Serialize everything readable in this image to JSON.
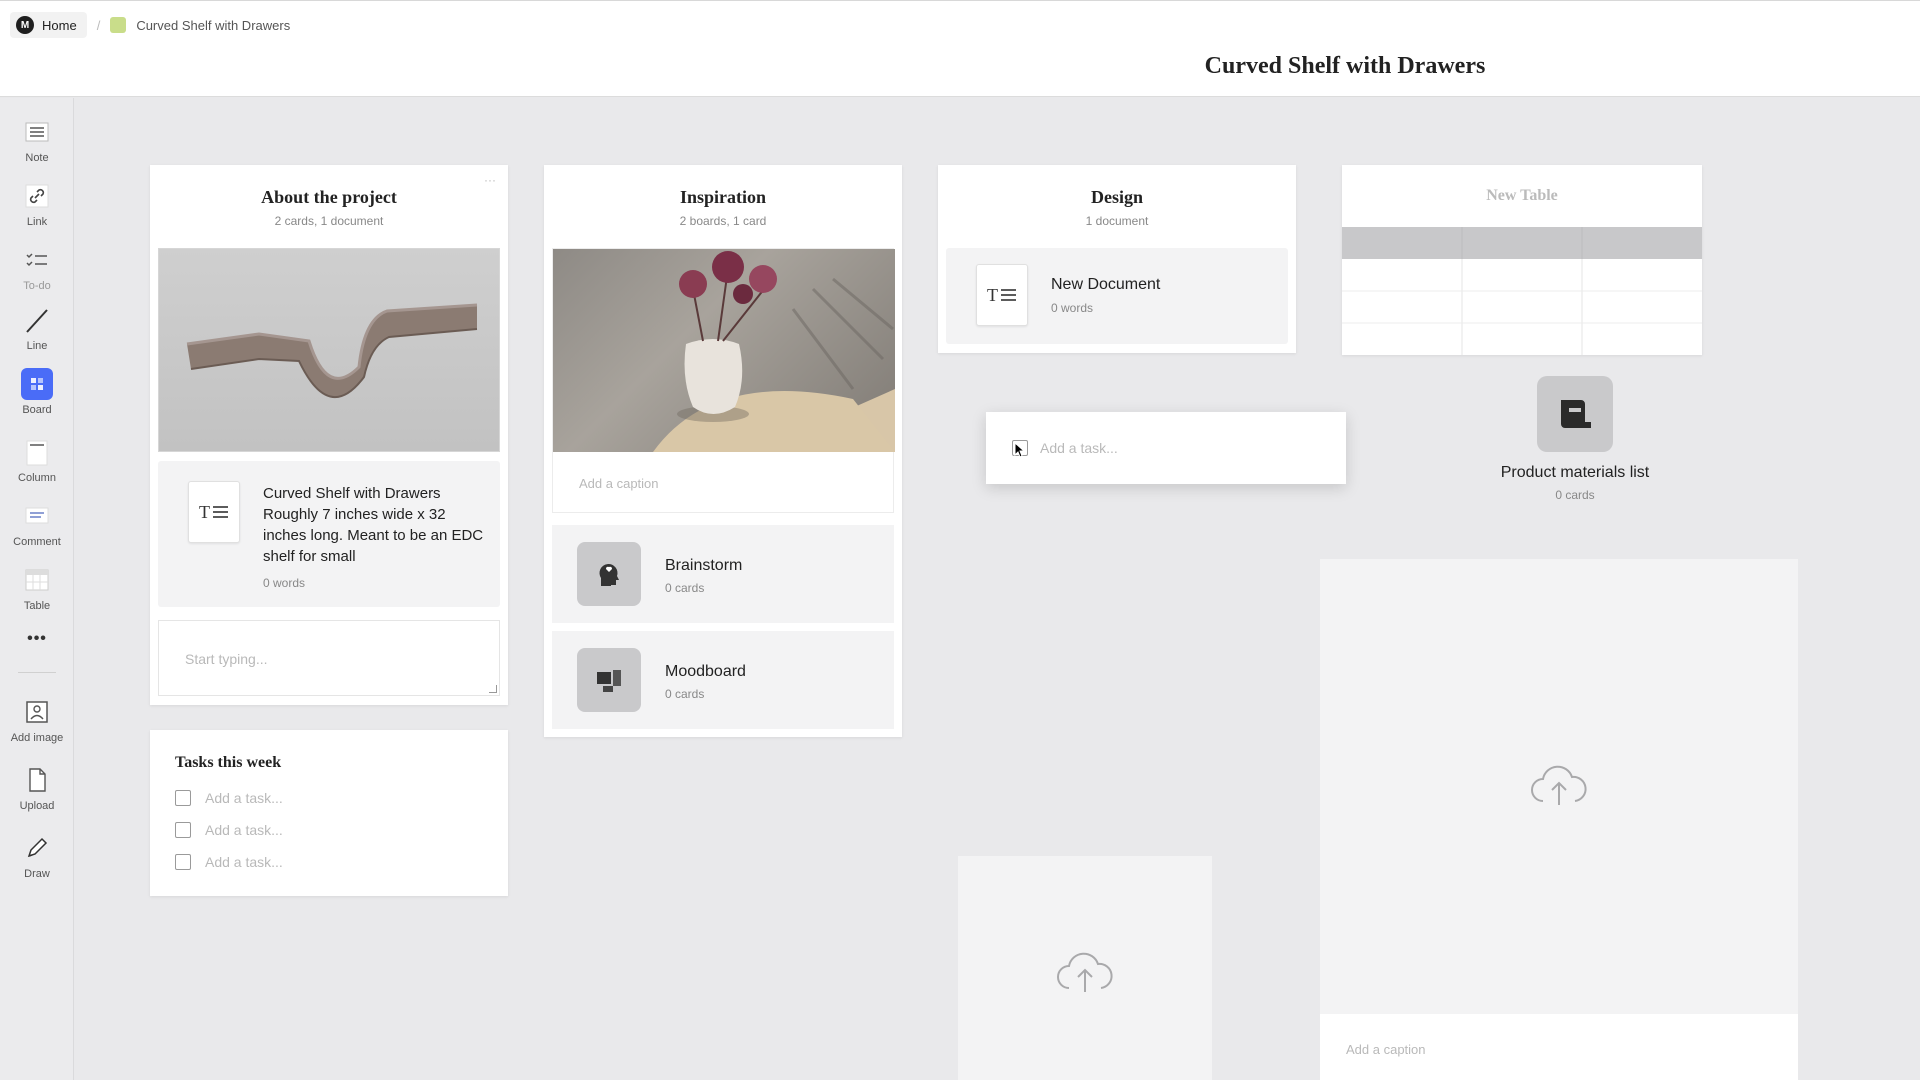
{
  "breadcrumb": {
    "home_label": "Home",
    "logo_letter": "M",
    "board_label": "Curved Shelf with Drawers",
    "board_color": "#c9dd8a"
  },
  "page_title": "Curved Shelf with Drawers",
  "sidebar": {
    "tools": [
      {
        "label": "Note",
        "icon": "note-icon"
      },
      {
        "label": "Link",
        "icon": "link-icon"
      },
      {
        "label": "To-do",
        "icon": "todo-icon"
      },
      {
        "label": "Line",
        "icon": "line-icon"
      },
      {
        "label": "Board",
        "icon": "board-icon"
      },
      {
        "label": "Column",
        "icon": "column-icon"
      },
      {
        "label": "Comment",
        "icon": "comment-icon"
      },
      {
        "label": "Table",
        "icon": "table-icon"
      },
      {
        "label": "Add image",
        "icon": "image-icon"
      },
      {
        "label": "Upload",
        "icon": "upload-icon"
      },
      {
        "label": "Draw",
        "icon": "pencil-icon"
      }
    ],
    "accent_color": "#4a6cf7"
  },
  "columns": {
    "about": {
      "title": "About the project",
      "subtitle": "2 cards, 1 document",
      "doc_title": "Curved Shelf with Drawers Roughly 7 inches wide x 32 inches long. Meant to be an EDC shelf for small",
      "doc_meta": "0 words",
      "note_placeholder": "Start typing..."
    },
    "inspiration": {
      "title": "Inspiration",
      "subtitle": "2 boards, 1 card",
      "caption_placeholder": "Add a caption",
      "boards": [
        {
          "name": "Brainstorm",
          "meta": "0 cards",
          "icon": "brainstorm-icon"
        },
        {
          "name": "Moodboard",
          "meta": "0 cards",
          "icon": "moodboard-icon"
        }
      ]
    },
    "design": {
      "title": "Design",
      "subtitle": "1 document",
      "doc_title": "New Document",
      "doc_meta": "0 words"
    }
  },
  "table": {
    "title": "New Table"
  },
  "floating_task": {
    "placeholder": "Add a task..."
  },
  "tasks": {
    "title": "Tasks this week",
    "items": [
      "Add a task...",
      "Add a task...",
      "Add a task..."
    ]
  },
  "materials": {
    "name": "Product materials list",
    "meta": "0 cards"
  },
  "upload_large": {
    "caption_placeholder": "Add a caption"
  }
}
